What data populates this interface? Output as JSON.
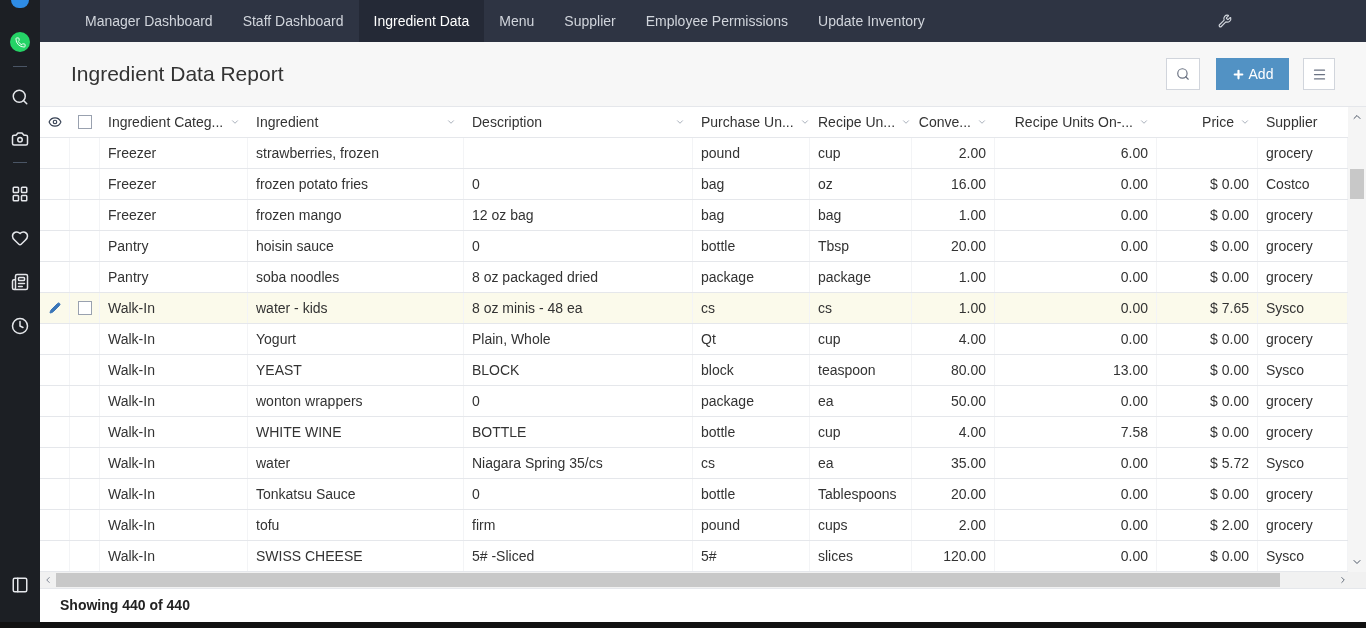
{
  "nav": {
    "tabs": [
      {
        "label": "Manager Dashboard",
        "selected": false
      },
      {
        "label": "Staff Dashboard",
        "selected": false
      },
      {
        "label": "Ingredient Data",
        "selected": true
      },
      {
        "label": "Menu",
        "selected": false
      },
      {
        "label": "Supplier",
        "selected": false
      },
      {
        "label": "Employee Permissions",
        "selected": false
      },
      {
        "label": "Update Inventory",
        "selected": false
      }
    ]
  },
  "report": {
    "title": "Ingredient Data Report",
    "add_button": "Add"
  },
  "table": {
    "select_all_checked": false,
    "columns": [
      {
        "label": "Ingredient Categ...",
        "kind": "text",
        "sortable": true
      },
      {
        "label": "Ingredient",
        "kind": "text",
        "sortable": true
      },
      {
        "label": "Description",
        "kind": "text",
        "sortable": true
      },
      {
        "label": "Purchase Un...",
        "kind": "text",
        "sortable": true
      },
      {
        "label": "Recipe Un...",
        "kind": "text",
        "sortable": true
      },
      {
        "label": "Conve...",
        "kind": "number",
        "sortable": true
      },
      {
        "label": "Recipe Units On-...",
        "kind": "number",
        "sortable": true
      },
      {
        "label": "Price",
        "kind": "number",
        "sortable": true
      },
      {
        "label": "Supplier",
        "kind": "text",
        "sortable": false
      }
    ],
    "rows": [
      {
        "hovered": false,
        "checked": false,
        "cells": [
          "Freezer",
          "strawberries, frozen",
          "",
          "pound",
          "cup",
          "2.00",
          "6.00",
          "",
          "grocery"
        ]
      },
      {
        "hovered": false,
        "checked": false,
        "cells": [
          "Freezer",
          "frozen potato fries",
          "0",
          "bag",
          "oz",
          "16.00",
          "0.00",
          "$ 0.00",
          "Costco"
        ]
      },
      {
        "hovered": false,
        "checked": false,
        "cells": [
          "Freezer",
          "frozen mango",
          "12 oz bag",
          "bag",
          "bag",
          "1.00",
          "0.00",
          "$ 0.00",
          "grocery"
        ]
      },
      {
        "hovered": false,
        "checked": false,
        "cells": [
          "Pantry",
          "hoisin sauce",
          "0",
          "bottle",
          "Tbsp",
          "20.00",
          "0.00",
          "$ 0.00",
          "grocery"
        ]
      },
      {
        "hovered": false,
        "checked": false,
        "cells": [
          "Pantry",
          "soba noodles",
          "8 oz packaged dried",
          "package",
          "package",
          "1.00",
          "0.00",
          "$ 0.00",
          "grocery"
        ]
      },
      {
        "hovered": true,
        "checked": false,
        "cells": [
          "Walk-In",
          "water - kids",
          "8 oz minis - 48 ea",
          "cs",
          "cs",
          "1.00",
          "0.00",
          "$ 7.65",
          "Sysco"
        ]
      },
      {
        "hovered": false,
        "checked": false,
        "cells": [
          "Walk-In",
          "Yogurt",
          "Plain, Whole",
          "Qt",
          "cup",
          "4.00",
          "0.00",
          "$ 0.00",
          "grocery"
        ]
      },
      {
        "hovered": false,
        "checked": false,
        "cells": [
          "Walk-In",
          "YEAST",
          "BLOCK",
          "block",
          "teaspoon",
          "80.00",
          "13.00",
          "$ 0.00",
          "Sysco"
        ]
      },
      {
        "hovered": false,
        "checked": false,
        "cells": [
          "Walk-In",
          "wonton wrappers",
          "0",
          "package",
          "ea",
          "50.00",
          "0.00",
          "$ 0.00",
          "grocery"
        ]
      },
      {
        "hovered": false,
        "checked": false,
        "cells": [
          "Walk-In",
          "WHITE WINE",
          "BOTTLE",
          "bottle",
          "cup",
          "4.00",
          "7.58",
          "$ 0.00",
          "grocery"
        ]
      },
      {
        "hovered": false,
        "checked": false,
        "cells": [
          "Walk-In",
          "water",
          "Niagara Spring 35/cs",
          "cs",
          "ea",
          "35.00",
          "0.00",
          "$ 5.72",
          "Sysco"
        ]
      },
      {
        "hovered": false,
        "checked": false,
        "cells": [
          "Walk-In",
          "Tonkatsu Sauce",
          "0",
          "bottle",
          "Tablespoons",
          "20.00",
          "0.00",
          "$ 0.00",
          "grocery"
        ]
      },
      {
        "hovered": false,
        "checked": false,
        "cells": [
          "Walk-In",
          "tofu",
          "firm",
          "pound",
          "cups",
          "2.00",
          "0.00",
          "$ 2.00",
          "grocery"
        ]
      },
      {
        "hovered": false,
        "checked": false,
        "cells": [
          "Walk-In",
          "SWISS CHEESE",
          "5# -Sliced",
          "5#",
          "slices",
          "120.00",
          "0.00",
          "$ 0.00",
          "Sysco"
        ]
      }
    ]
  },
  "footer": {
    "count": "Showing 440 of 440"
  }
}
